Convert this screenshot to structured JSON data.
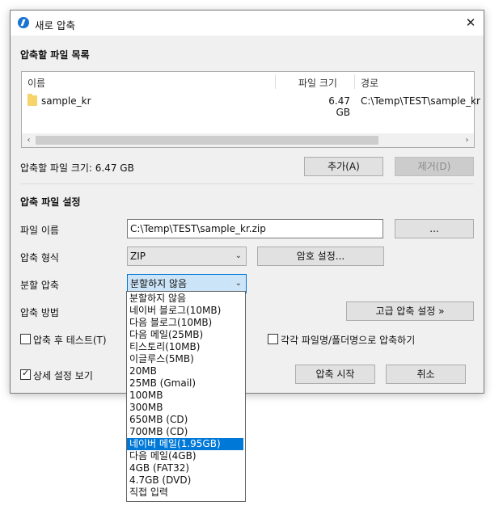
{
  "window": {
    "title": "새로 압축",
    "close": "✕"
  },
  "files_section": {
    "title": "압축할 파일 목록",
    "columns": {
      "name": "이름",
      "size": "파일 크기",
      "path": "경로"
    },
    "rows": [
      {
        "name": "sample_kr",
        "size": "6.47 GB",
        "path": "C:\\Temp\\TEST\\sample_kr"
      }
    ],
    "total_size_label": "압축할 파일 크기: 6.47 GB",
    "add_button": "추가(A)",
    "remove_button": "제거(D)"
  },
  "settings_section": {
    "title": "압축 파일 설정",
    "filename_label": "파일 이름",
    "filename_value": "C:\\Temp\\TEST\\sample_kr.zip",
    "browse_button": "...",
    "format_label": "압축 형식",
    "format_value": "ZIP",
    "password_button": "암호 설정...",
    "split_label": "분할 압축",
    "split_value": "분할하지 않음",
    "method_label": "압축 방법",
    "advanced_button": "고급 압축 설정 »",
    "test_after_checkbox": {
      "label": "압축 후 테스트(T)",
      "checked": false
    },
    "each_file_checkbox": {
      "label": "각각 파일명/폴더명으로 압축하기",
      "checked": false
    },
    "details_checkbox": {
      "label": "상세 설정 보기",
      "checked": true
    },
    "start_button": "압축 시작",
    "cancel_button": "취소"
  },
  "split_dropdown": {
    "selected_index": 12,
    "options": [
      "분할하지 않음",
      "네이버 블로그(10MB)",
      "다음 블로그(10MB)",
      "다음 메일(25MB)",
      "티스토리(10MB)",
      "이글루스(5MB)",
      "20MB",
      "25MB (Gmail)",
      "100MB",
      "300MB",
      "650MB (CD)",
      "700MB (CD)",
      "네이버 메일(1.95GB)",
      "다음 메일(4GB)",
      "4GB (FAT32)",
      "4.7GB (DVD)",
      "직접 입력"
    ]
  },
  "colors": {
    "accent": "#0078d7",
    "window_bg": "#f0f0f0",
    "folder": "#f6d36b"
  }
}
